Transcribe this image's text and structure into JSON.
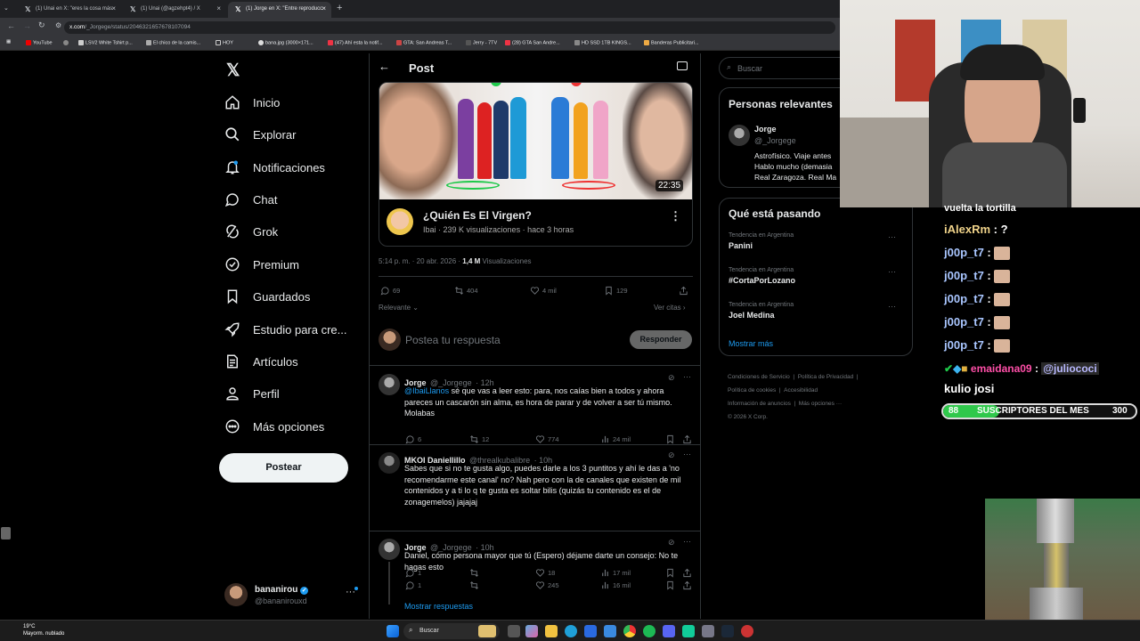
{
  "browser": {
    "tabs": [
      {
        "label": "(1) Unai en X: \"eres la cosa más",
        "active": false
      },
      {
        "label": "(1) Unai (@agzehpt4) / X",
        "active": false
      },
      {
        "label": "(1) Jorge en X: \"Entre reproducc",
        "active": true
      }
    ],
    "new_tab": "+",
    "url_host": "x.com",
    "url_path": "/_Jorgege/status/2046321657678107094",
    "bookmarks": [
      "YouTube",
      "LSV2 White Tshirt p...",
      "El chico de la camis...",
      "HOY",
      "bana.jpg (3000×171...",
      "(47) Ahí esta la notif...",
      "GTA: San Andreas T...",
      "Jerry - 7TV",
      "(28) GTA San Andre...",
      "HD SSD 1TB KINGS...",
      "Banderas Publicitari..."
    ]
  },
  "nav": {
    "items": [
      {
        "label": "Inicio",
        "icon": "home-icon"
      },
      {
        "label": "Explorar",
        "icon": "search-icon"
      },
      {
        "label": "Notificaciones",
        "icon": "bell-icon"
      },
      {
        "label": "Chat",
        "icon": "chat-icon"
      },
      {
        "label": "Grok",
        "icon": "grok-icon"
      },
      {
        "label": "Premium",
        "icon": "premium-icon"
      },
      {
        "label": "Guardados",
        "icon": "bookmark-icon"
      },
      {
        "label": "Estudio para cre...",
        "icon": "rocket-icon"
      },
      {
        "label": "Artículos",
        "icon": "article-icon"
      },
      {
        "label": "Perfil",
        "icon": "person-icon"
      },
      {
        "label": "Más opciones",
        "icon": "more-circle-icon"
      }
    ],
    "post_button": "Postear",
    "account": {
      "name": "bananirou",
      "handle": "@bananirouxd"
    }
  },
  "post_header": {
    "title": "Post"
  },
  "video_card": {
    "duration": "22:35",
    "title": "¿Quién Es El Virgen?",
    "channel": "Ibai",
    "views": "239 K visualizaciones",
    "time": "hace 3 horas"
  },
  "post_meta": {
    "time": "5:14 p. m. · 20 abr. 2026 · ",
    "views_count": "1,4 M",
    "views_label": " Visualizaciones"
  },
  "post_actions": {
    "replies": "69",
    "reposts": "404",
    "likes": "4 mil",
    "bookmarks": "129"
  },
  "sort": {
    "relevant": "Relevante",
    "quotes": "Ver citas"
  },
  "reply_box": {
    "placeholder": "Postea tu respuesta",
    "button": "Responder"
  },
  "replies": [
    {
      "name": "Jorge",
      "handle": "@_Jorgege",
      "time": "· 12h",
      "mention": "@IbaiLlanos",
      "text": " sé que vas a leer esto: para, nos caías bien a todos y ahora pareces un cascarón sin alma, es hora de parar y de volver a ser tú mismo. Molabas",
      "replies": "6",
      "reposts": "12",
      "likes": "774",
      "views": "24 mil"
    },
    {
      "name": "MKOI Daniellillo",
      "handle": "@threalkubalibre",
      "time": "· 10h",
      "text": "Sabes que si no te gusta algo, puedes darle a los 3 puntitos y ahí le das a 'no recomendarme este canal' no? Nah pero con la de canales que existen de mil contenidos y a ti lo q te gusta es soltar bilis (quizás tu contenido es el de zonagemelos) jajajaj",
      "replies": "1",
      "reposts": "",
      "likes": "18",
      "views": "17 mil"
    },
    {
      "name": "Jorge",
      "handle": "@_Jorgege",
      "time": "· 10h",
      "text": "Daniel, cómo persona mayor que tú (Espero) déjame darte un consejo: No te hagas esto",
      "replies": "1",
      "reposts": "",
      "likes": "245",
      "views": "16 mil"
    }
  ],
  "show_replies": "Mostrar respuestas",
  "right": {
    "search_placeholder": "Buscar",
    "relevant_title": "Personas relevantes",
    "person": {
      "name": "Jorge",
      "handle": "@_Jorgege",
      "bio": "Astrofísico. Viaje antes Hablo mucho (demasia Real Zaragoza. Real Ma"
    },
    "trends_title": "Qué está pasando",
    "trends": [
      {
        "context": "Tendencia en Argentina",
        "name": "Panini"
      },
      {
        "context": "Tendencia en Argentina",
        "name": "#CortaPorLozano"
      },
      {
        "context": "Tendencia en Argentina",
        "name": "Joel Medina"
      }
    ],
    "show_more": "Mostrar más",
    "footer": [
      "Condiciones de Servicio",
      "|",
      "Política de Privacidad",
      "|",
      "Política de cookies",
      "|",
      "Accesibilidad",
      "|",
      "Información de anuncios",
      "|",
      "Más opciones ···",
      "© 2026 X Corp."
    ]
  },
  "stream_chat": {
    "top_line": "vuelta la tortilla",
    "lines": [
      {
        "user": "iAlexRm",
        "msg": " : ?",
        "color": "#f0d38a"
      },
      {
        "user": "j00p_t7",
        "msg": " :",
        "color": "#a9c6ff"
      },
      {
        "user": "j00p_t7",
        "msg": " :",
        "color": "#a9c6ff"
      },
      {
        "user": "j00p_t7",
        "msg": " :",
        "color": "#a9c6ff"
      },
      {
        "user": "j00p_t7",
        "msg": " :",
        "color": "#a9c6ff"
      },
      {
        "user": "j00p_t7",
        "msg": " :",
        "color": "#a9c6ff"
      }
    ],
    "mention_user": "emaidana09",
    "mention_target": "@juliococi",
    "last": "kulio josi",
    "sub_goal": {
      "current": "88",
      "label": "SUSCRIPTORES DEL MES",
      "target": "300",
      "fraction": 0.293
    }
  },
  "taskbar": {
    "weather_temp": "19°C",
    "weather_desc": "Mayorm. nublado",
    "search": "Buscar"
  }
}
